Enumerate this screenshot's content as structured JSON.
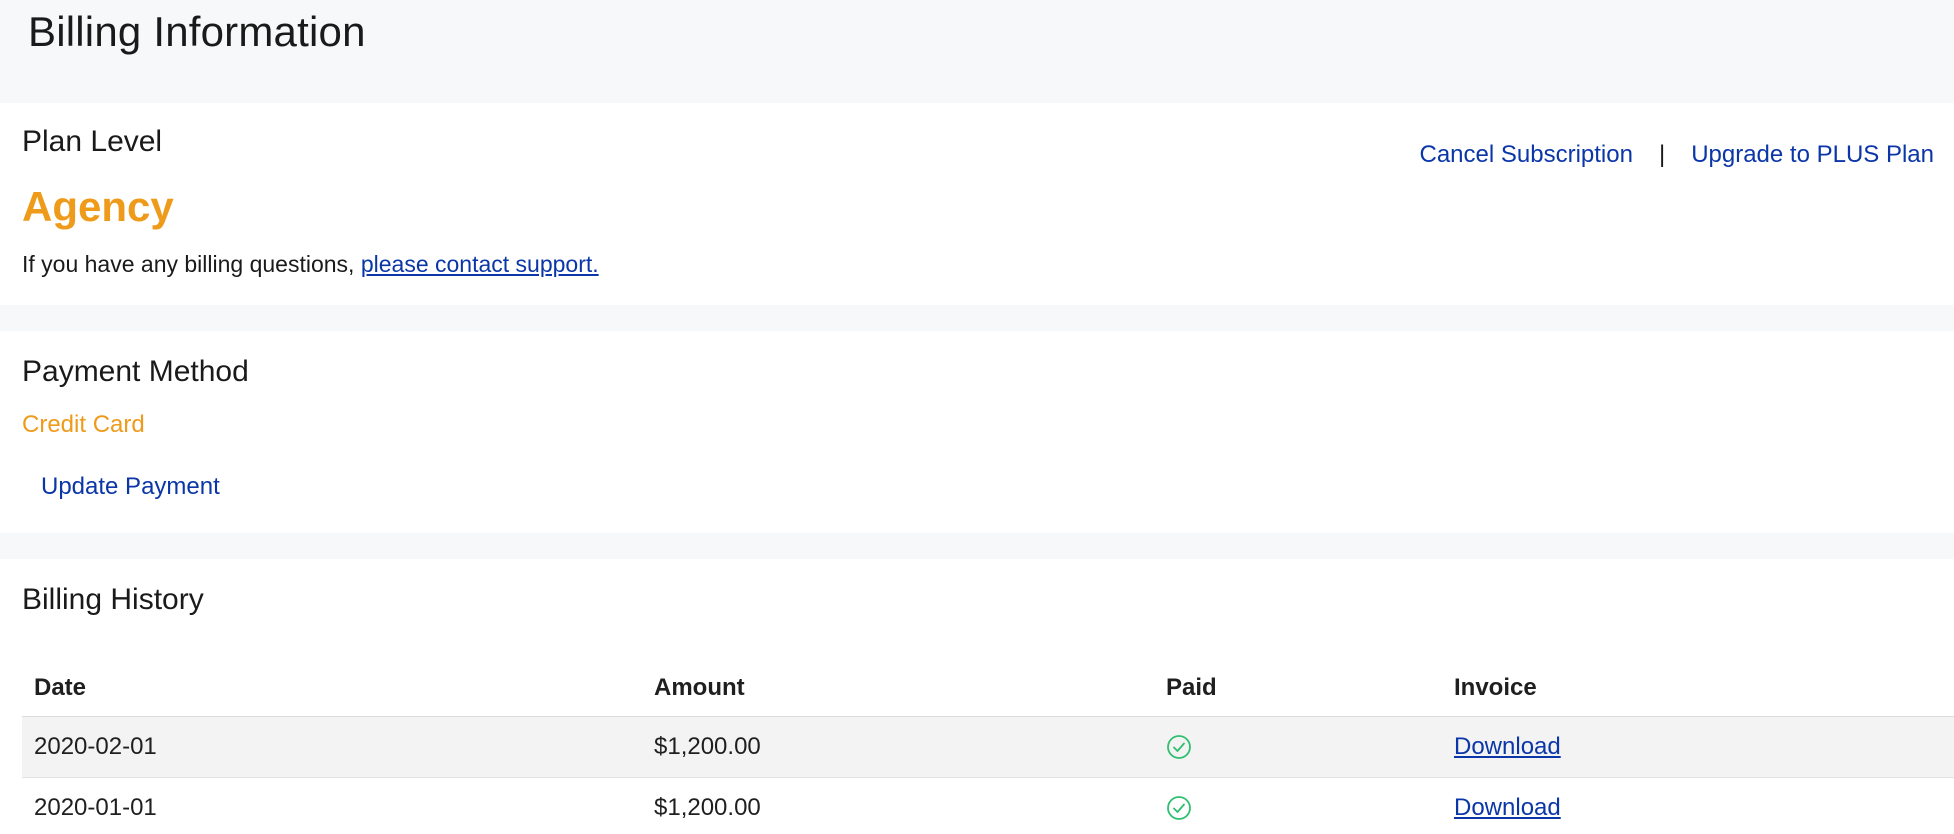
{
  "header": {
    "title": "Billing Information"
  },
  "plan": {
    "section_title": "Plan Level",
    "plan_name": "Agency",
    "note_text": "If you have any billing questions, ",
    "note_link": "please contact support.",
    "cancel_label": "Cancel Subscription",
    "separator": "|",
    "upgrade_label": "Upgrade to PLUS Plan"
  },
  "payment": {
    "section_title": "Payment Method",
    "method": "Credit Card",
    "update_label": "Update Payment"
  },
  "history": {
    "section_title": "Billing History",
    "columns": [
      "Date",
      "Amount",
      "Paid",
      "Invoice"
    ],
    "rows": [
      {
        "date": "2020-02-01",
        "amount": "$1,200.00",
        "paid": "check-icon",
        "invoice": "Download"
      },
      {
        "date": "2020-01-01",
        "amount": "$1,200.00",
        "paid": "check-icon",
        "invoice": "Download"
      }
    ]
  },
  "colors": {
    "accent_orange": "#ee9b1c",
    "link_blue": "#0b36a8",
    "paid_green": "#2fbf71",
    "page_bg": "#f7f8fa"
  }
}
